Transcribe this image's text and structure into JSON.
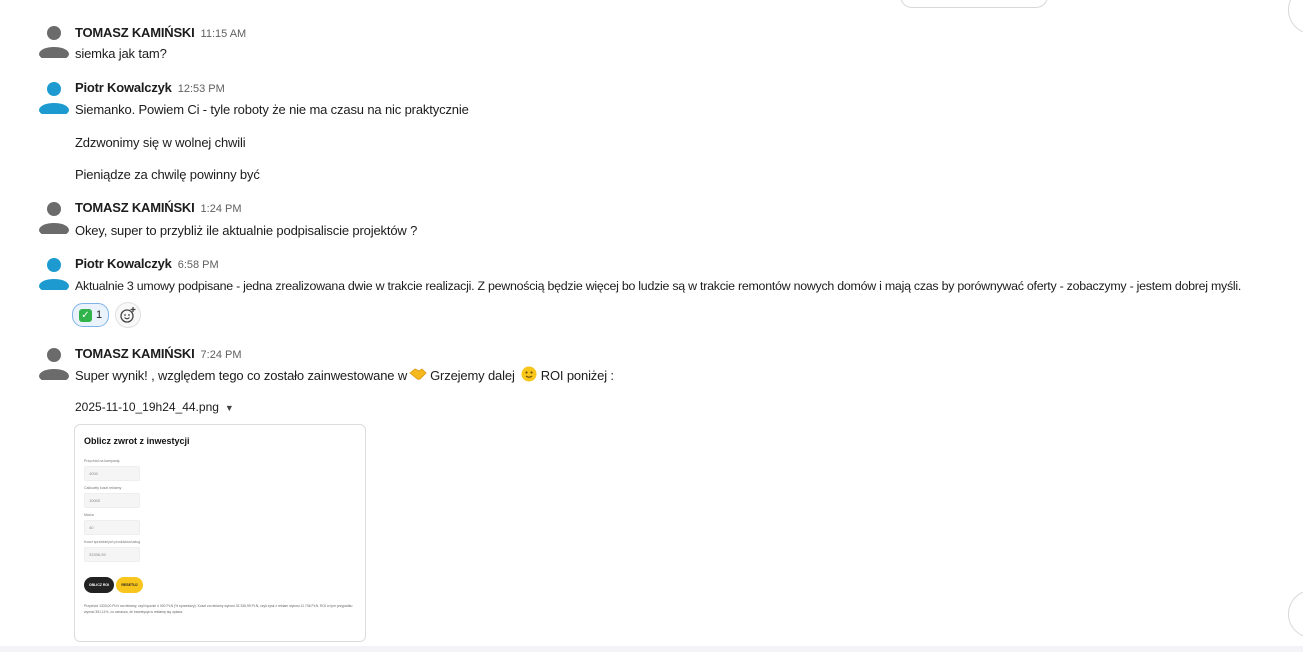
{
  "colors": {
    "accent_blue": "#1d9bd1",
    "avatar_gray": "#6b6b6b",
    "reaction_border": "#7fb3e6",
    "reaction_bg": "#eaf3fc",
    "check_green": "#2fb34a"
  },
  "icons": {
    "avatar_tomasz": "user-avatar-gray-icon",
    "avatar_piotr": "user-avatar-blue-icon",
    "reaction": "white-check-mark-icon",
    "add_reaction": "add-reaction-icon",
    "emoji_handshake": "handshake-icon",
    "emoji_smile": "slightly-smiling-face-icon",
    "file_menu": "caret-down-icon"
  },
  "messages": [
    {
      "author": "TOMASZ KAMIŃSKI",
      "time": "11:15 AM",
      "lines": [
        "siemka jak tam?"
      ]
    },
    {
      "author": "Piotr Kowalczyk",
      "time": "12:53 PM",
      "lines": [
        "Siemanko. Powiem Ci -  tyle roboty że nie ma czasu na nic praktycznie",
        "Zdzwonimy się w wolnej chwili",
        "Pieniądze za chwilę powinny być"
      ]
    },
    {
      "author": "TOMASZ KAMIŃSKI",
      "time": "1:24 PM",
      "lines": [
        "Okey, super to przybliż ile aktualnie podpisaliscie projektów  ?"
      ]
    },
    {
      "author": "Piotr Kowalczyk",
      "time": "6:58 PM",
      "lines": [
        "Aktualnie 3 umowy podpisane - jedna zrealizowana dwie w trakcie realizacji. Z pewnością będzie więcej bo ludzie są w trakcie remontów nowych domów i mają czas by porównywać oferty - zobaczymy - jestem dobrej myśli."
      ],
      "reaction": {
        "count": "1"
      }
    },
    {
      "author": "TOMASZ KAMIŃSKI",
      "time": "7:24 PM",
      "text_part1": "Super wynik! , względem tego co zostało zainwestowane w",
      "text_part2": "Grzejemy dalej",
      "text_part3": "ROI poniżej :",
      "attachment": {
        "filename": "2025-11-10_19h24_44.png"
      }
    }
  ]
}
